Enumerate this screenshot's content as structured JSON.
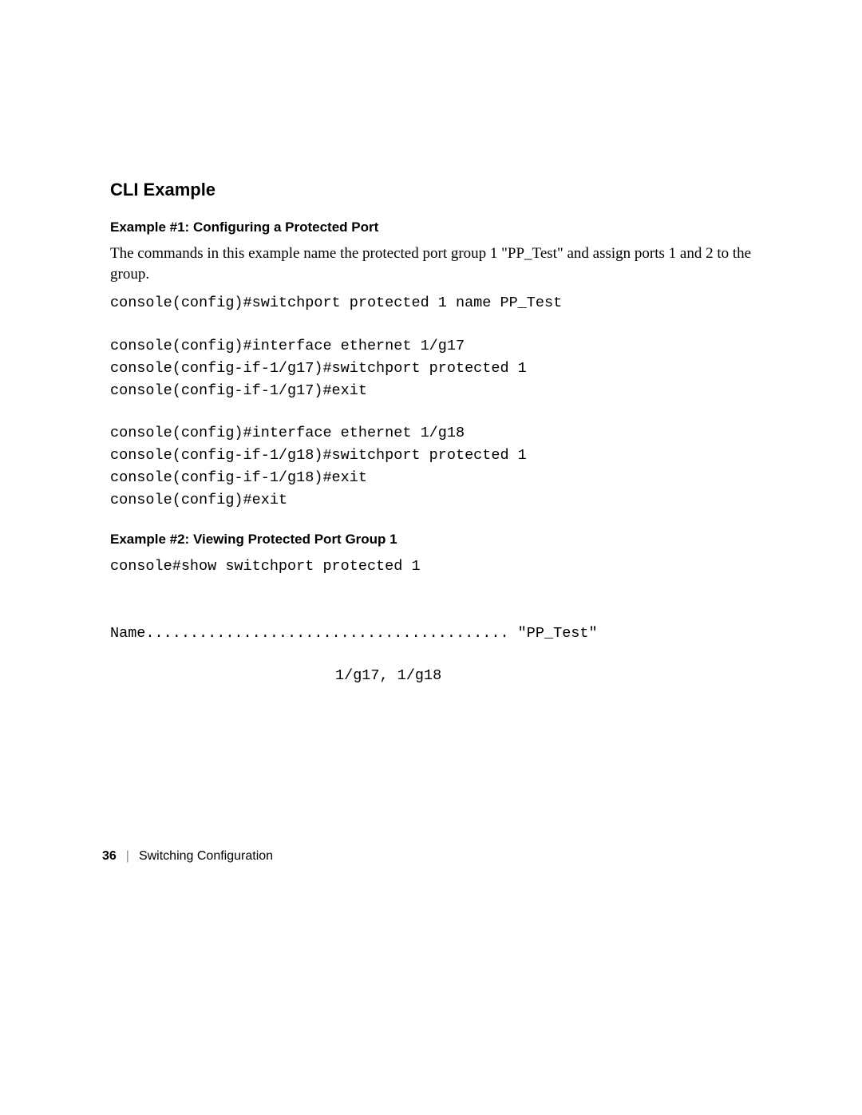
{
  "heading": "CLI Example",
  "example1": {
    "title": "Example #1: Configuring a Protected Port",
    "desc": "The commands in this example name the protected port group 1 \"PP_Test\" and assign ports 1 and 2 to the group.",
    "code1": "console(config)#switchport protected 1 name PP_Test",
    "code2": "console(config)#interface ethernet 1/g17\nconsole(config-if-1/g17)#switchport protected 1\nconsole(config-if-1/g17)#exit",
    "code3": "console(config)#interface ethernet 1/g18\nconsole(config-if-1/g18)#switchport protected 1\nconsole(config-if-1/g18)#exit\nconsole(config)#exit"
  },
  "example2": {
    "title": "Example #2: Viewing Protected Port Group 1",
    "code1": "console#show switchport protected 1",
    "output_name": "Name......................................... \"PP_Test\"",
    "output_ports": "1/g17, 1/g18"
  },
  "footer": {
    "page": "36",
    "divider": "|",
    "section": "Switching Configuration"
  }
}
